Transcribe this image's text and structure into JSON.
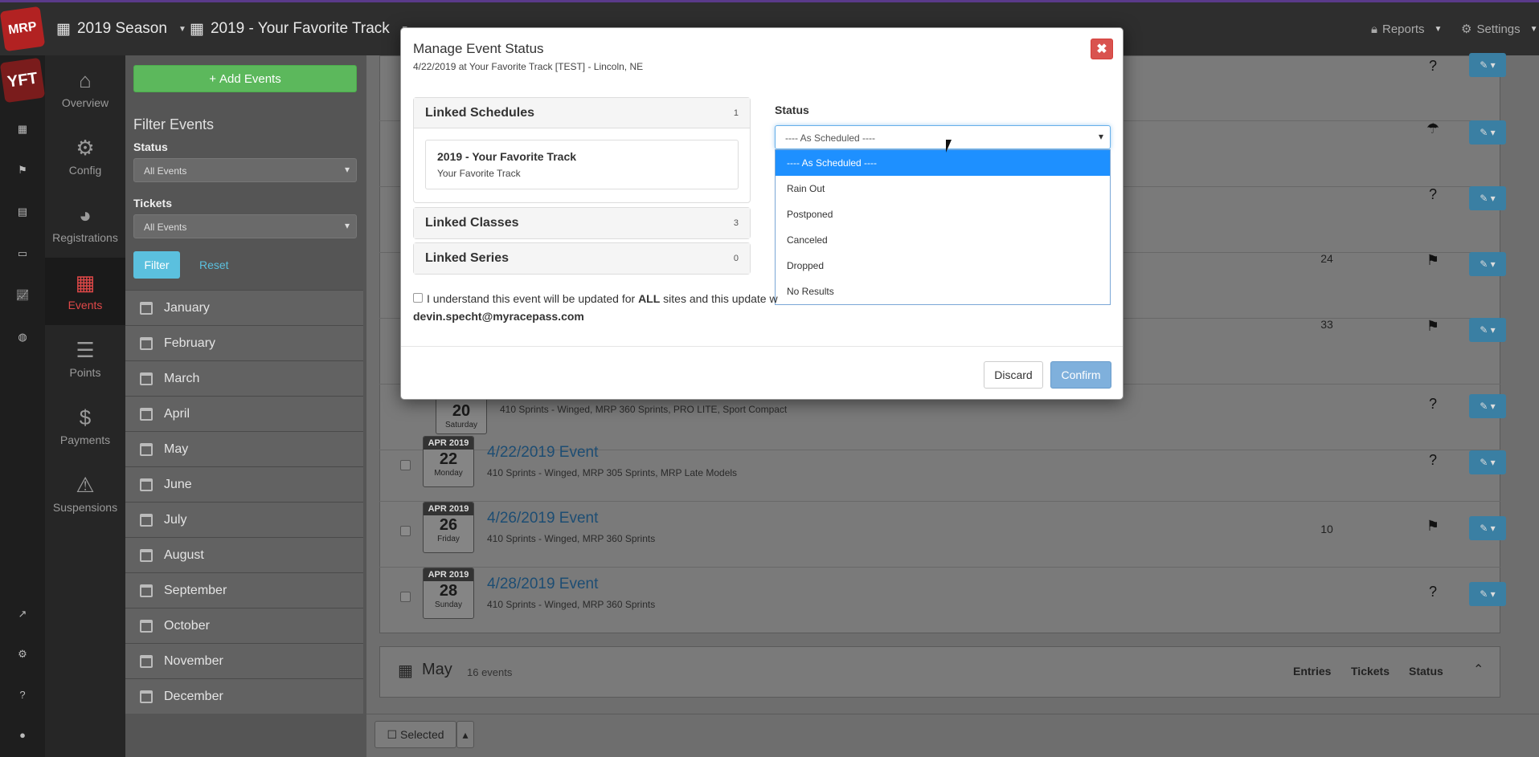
{
  "topbar": {
    "season": "2019 Season",
    "schedule": "2019 - Your Favorite Track",
    "reports": "Reports",
    "settings": "Settings"
  },
  "rail": {
    "logo": "MRP",
    "track_logo": "YFT",
    "icons": [
      "calendar-icon",
      "flag-icon",
      "registration-card-icon",
      "ticket-icon",
      "chart-icon",
      "globe-icon",
      "external-link-icon",
      "gear-icon",
      "help-icon",
      "user-icon"
    ]
  },
  "sidenav": {
    "items": [
      {
        "label": "Overview",
        "icon": "home-icon"
      },
      {
        "label": "Config",
        "icon": "gear-icon"
      },
      {
        "label": "Registrations",
        "icon": "helmet-icon"
      },
      {
        "label": "Events",
        "icon": "calendar-icon"
      },
      {
        "label": "Points",
        "icon": "list-icon"
      },
      {
        "label": "Payments",
        "icon": "dollar-icon"
      },
      {
        "label": "Suspensions",
        "icon": "warning-icon"
      }
    ]
  },
  "filter": {
    "add_label": "Add Events",
    "title": "Filter Events",
    "status_label": "Status",
    "status_value": "All Events",
    "tickets_label": "Tickets",
    "tickets_value": "All Events",
    "filter_btn": "Filter",
    "reset_btn": "Reset",
    "months": [
      "January",
      "February",
      "March",
      "April",
      "May",
      "June",
      "July",
      "August",
      "September",
      "October",
      "November",
      "December"
    ]
  },
  "events": [
    {
      "entries": "",
      "status": "?"
    },
    {
      "entries": "",
      "status": "☂"
    },
    {
      "entries": "",
      "status": "?"
    },
    {
      "entries": "24",
      "status": "⚑"
    },
    {
      "entries": "33",
      "status": "⚑"
    },
    {
      "month": "",
      "day": "20",
      "weekday": "Saturday",
      "title": "",
      "classes": "410 Sprints - Winged, MRP 360 Sprints, PRO LITE, Sport Compact",
      "entries": "",
      "status": "?"
    },
    {
      "month": "APR 2019",
      "day": "22",
      "weekday": "Monday",
      "title": "4/22/2019 Event",
      "classes": "410 Sprints - Winged, MRP 305 Sprints, MRP Late Models",
      "entries": "",
      "status": "?"
    },
    {
      "month": "APR 2019",
      "day": "26",
      "weekday": "Friday",
      "title": "4/26/2019 Event",
      "classes": "410 Sprints - Winged, MRP 360 Sprints",
      "entries": "10",
      "status": "⚑"
    },
    {
      "month": "APR 2019",
      "day": "28",
      "weekday": "Sunday",
      "title": "4/28/2019 Event",
      "classes": "410 Sprints - Winged, MRP 360 Sprints",
      "entries": "",
      "status": "?"
    }
  ],
  "may_header": {
    "title": "May",
    "count": "16 events",
    "col_entries": "Entries",
    "col_tickets": "Tickets",
    "col_status": "Status"
  },
  "bottom": {
    "selected": "Selected"
  },
  "modal": {
    "title": "Manage Event Status",
    "subtitle": "4/22/2019 at Your Favorite Track [TEST] - Lincoln, NE",
    "linked_schedules": "Linked Schedules",
    "linked_schedules_count": "1",
    "schedule_title": "2019 - Your Favorite Track",
    "schedule_sub": "Your Favorite Track",
    "linked_classes": "Linked Classes",
    "linked_classes_count": "3",
    "linked_series": "Linked Series",
    "linked_series_count": "0",
    "status_label": "Status",
    "status_value": "---- As Scheduled ----",
    "status_options": [
      "---- As Scheduled ----",
      "Rain Out",
      "Postponed",
      "Canceled",
      "Dropped",
      "No Results"
    ],
    "confirm_text_before": "I understand this event will be updated for ",
    "confirm_text_bold": "ALL",
    "confirm_text_after": " sites and this update w",
    "email": "devin.specht@myracepass.com",
    "discard": "Discard",
    "confirm": "Confirm"
  }
}
